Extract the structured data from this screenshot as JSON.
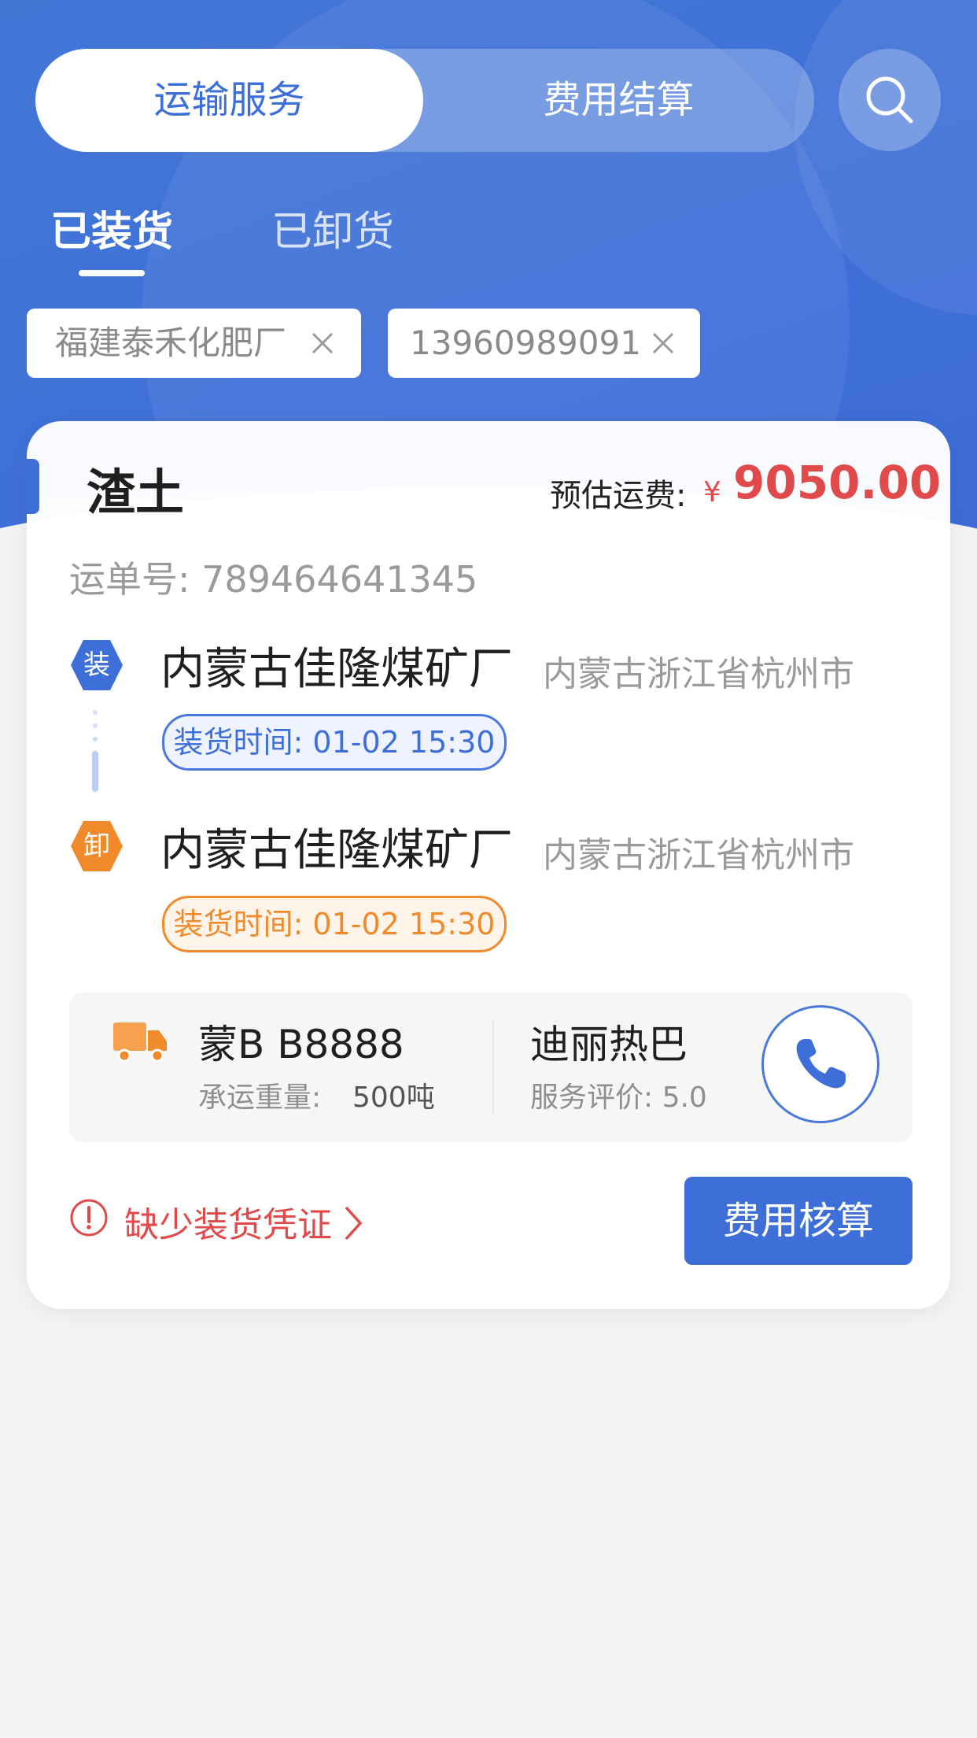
{
  "segment": {
    "active": "运输服务",
    "inactive": "费用结算"
  },
  "subtabs": [
    "已装货",
    "已卸货"
  ],
  "filters": [
    "福建泰禾化肥厂",
    "13960989091"
  ],
  "order": {
    "cargo": "渣土",
    "fee_label": "预估运费:",
    "currency": "¥",
    "fee": "9050.00",
    "waybill": "运单号: 789464641345",
    "load": {
      "badge": "装",
      "place": "内蒙古佳隆煤矿厂",
      "region": "内蒙古浙江省杭州市",
      "time": "装货时间: 01-02 15:30"
    },
    "unload": {
      "badge": "卸",
      "place": "内蒙古佳隆煤矿厂",
      "region": "内蒙古浙江省杭州市",
      "time": "装货时间: 01-02 15:30"
    },
    "vehicle": {
      "plate": "蒙B B8888",
      "weight_label": "承运重量:",
      "weight": "500吨"
    },
    "driver": {
      "name": "迪丽热巴",
      "rating": "服务评价: 5.0"
    },
    "warning": "缺少装货凭证",
    "action": "费用核算"
  },
  "colors": {
    "primary": "#3e6fd9",
    "price": "#e04a4a",
    "unload": "#f08a2a"
  }
}
